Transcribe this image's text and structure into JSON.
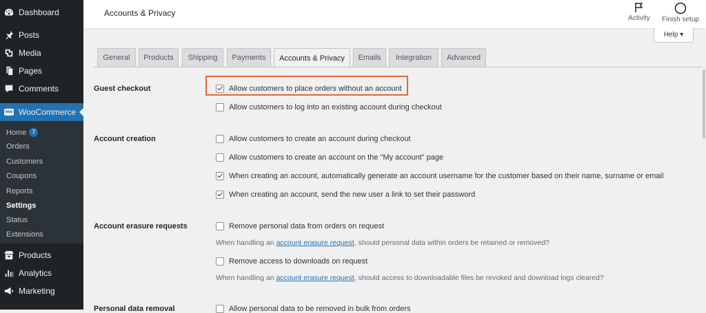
{
  "sidebar": {
    "items": [
      {
        "label": "Dashboard",
        "icon": "dashboard-icon"
      },
      {
        "label": "Posts",
        "icon": "pin-icon"
      },
      {
        "label": "Media",
        "icon": "media-icon"
      },
      {
        "label": "Pages",
        "icon": "pages-icon"
      },
      {
        "label": "Comments",
        "icon": "comments-icon"
      },
      {
        "label": "WooCommerce",
        "icon": "woocommerce-icon",
        "badge_text": "woo"
      },
      {
        "label": "Products",
        "icon": "products-icon"
      },
      {
        "label": "Analytics",
        "icon": "analytics-icon"
      },
      {
        "label": "Marketing",
        "icon": "marketing-icon"
      }
    ],
    "submenu": [
      {
        "label": "Home",
        "count": "7"
      },
      {
        "label": "Orders"
      },
      {
        "label": "Customers"
      },
      {
        "label": "Coupons"
      },
      {
        "label": "Reports"
      },
      {
        "label": "Settings"
      },
      {
        "label": "Status"
      },
      {
        "label": "Extensions"
      }
    ]
  },
  "header": {
    "title": "Accounts & Privacy",
    "activity_label": "Activity",
    "finish_setup_label": "Finish setup",
    "help_label": "Help ▾"
  },
  "tabs": [
    {
      "label": "General"
    },
    {
      "label": "Products"
    },
    {
      "label": "Shipping"
    },
    {
      "label": "Payments"
    },
    {
      "label": "Accounts & Privacy"
    },
    {
      "label": "Emails"
    },
    {
      "label": "Integration"
    },
    {
      "label": "Advanced"
    }
  ],
  "sections": {
    "guest_checkout": {
      "label": "Guest checkout",
      "options": [
        {
          "label": "Allow customers to place orders without an account",
          "checked": true
        },
        {
          "label": "Allow customers to log into an existing account during checkout",
          "checked": false
        }
      ]
    },
    "account_creation": {
      "label": "Account creation",
      "options": [
        {
          "label": "Allow customers to create an account during checkout",
          "checked": false
        },
        {
          "label": "Allow customers to create an account on the \"My account\" page",
          "checked": false
        },
        {
          "label": "When creating an account, automatically generate an account username for the customer based on their name, surname or email",
          "checked": true
        },
        {
          "label": "When creating an account, send the new user a link to set their password",
          "checked": true
        }
      ]
    },
    "erasure": {
      "label": "Account erasure requests",
      "options": [
        {
          "label": "Remove personal data from orders on request",
          "checked": false
        },
        {
          "label": "Remove access to downloads on request",
          "checked": false
        }
      ],
      "desc1_before": "When handling an ",
      "desc1_link": "account erasure request",
      "desc1_after": ", should personal data within orders be retained or removed?",
      "desc2_before": "When handling an ",
      "desc2_link": "account erasure request",
      "desc2_after": ", should access to downloadable files be revoked and download logs cleared?"
    },
    "removal": {
      "label": "Personal data removal",
      "options": [
        {
          "label": "Allow personal data to be removed in bulk from orders",
          "checked": false
        }
      ]
    }
  },
  "colors": {
    "sidebar_bg": "#1d2327",
    "accent": "#2271b1",
    "highlight": "#e2663c"
  }
}
